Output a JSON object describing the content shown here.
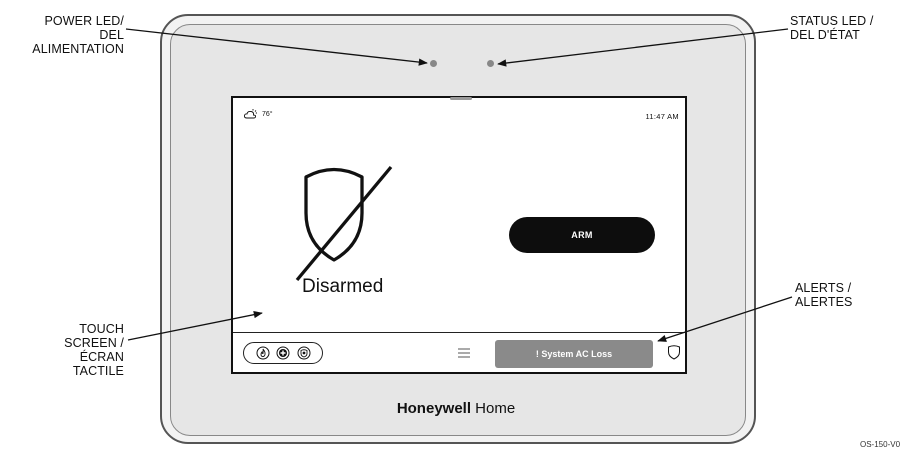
{
  "callouts": {
    "power_led": [
      "POWER LED/",
      "DEL",
      "ALIMENTATION"
    ],
    "status_led": [
      "STATUS LED /",
      "DEL D'ÉTAT"
    ],
    "touch_screen": [
      "TOUCH",
      "SCREEN /",
      "ÉCRAN",
      "TACTILE"
    ],
    "alerts": [
      "ALERTS /",
      "ALERTES"
    ]
  },
  "screen": {
    "temperature": "76°",
    "time": "11:47 AM",
    "state": "Disarmed",
    "arm_label": "ARM",
    "alert_label": "! System AC Loss"
  },
  "brand": {
    "bold": "Honeywell",
    "light": "Home"
  },
  "doc_code": "OS-150-V0",
  "icons": [
    "weather-icon",
    "disarmed-shield-icon",
    "fire-icon",
    "medical-icon",
    "police-icon",
    "menu-icon",
    "shield-icon"
  ]
}
